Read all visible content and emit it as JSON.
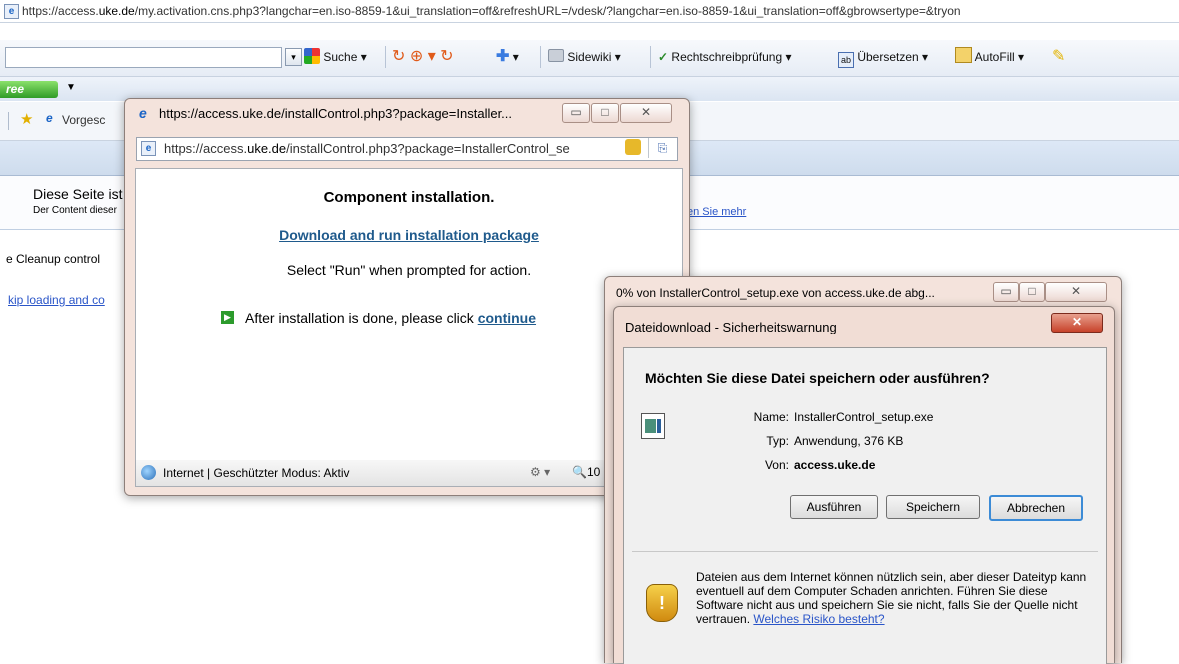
{
  "browser": {
    "url": "https://access.uke.de/my.activation.cns.php3?langchar=en.iso-8859-1&ui_translation=off&refreshURL=/vdesk/?langchar=en.iso-8859-1&ui_translation=off&gbrowsertype=&tryon",
    "url_prefix": "https://access.",
    "url_domain": "uke.de",
    "url_rest": "/my.activation.cns.php3?langchar=en.iso-8859-1&ui_translation=off&refreshURL=/vdesk/?langchar=en.iso-8859-1&ui_translation=off&gbrowsertype=&tryon",
    "toolbar": {
      "search": "Suche",
      "sidewiki": "Sidewiki",
      "spellcheck": "Rechtschreibprüfung",
      "translate": "Übersetzen",
      "autofill": "AutoFill"
    },
    "free_label": "ree",
    "favorites_label": "Vorgesc"
  },
  "page": {
    "info_title": "Diese Seite ist",
    "info_sub": "Der Content dieser",
    "info_link": "en Sie mehr",
    "cleanup_text": "e Cleanup control",
    "skip_link": "kip loading and co"
  },
  "popup": {
    "title": "https://access.uke.de/installControl.php3?package=Installer...",
    "address": "https://access.uke.de/installControl.php3?package=InstallerControl_se",
    "address_prefix": "https://access.",
    "address_domain": "uke.de",
    "address_rest": "/installControl.php3?package=InstallerControl_se",
    "heading": "Component installation.",
    "download_link": "Download and run installation package",
    "instruction": "Select \"Run\" when prompted for action.",
    "after_text": "After installation is done, please click",
    "continue_link": "continue",
    "status": "Internet | Geschützter Modus: Aktiv",
    "zoom": "10"
  },
  "progress_window": {
    "title": "0% von InstallerControl_setup.exe von access.uke.de abg..."
  },
  "dialog": {
    "title": "Dateidownload - Sicherheitswarnung",
    "question": "Möchten Sie diese Datei speichern oder ausführen?",
    "name_label": "Name:",
    "name_value": "InstallerControl_setup.exe",
    "type_label": "Typ:",
    "type_value": "Anwendung, 376 KB",
    "from_label": "Von:",
    "from_value": "access.uke.de",
    "btn_run": "Ausführen",
    "btn_save": "Speichern",
    "btn_cancel": "Abbrechen",
    "warning_text": "Dateien aus dem Internet können nützlich sein, aber dieser Dateityp kann eventuell auf dem Computer Schaden anrichten. Führen Sie diese Software nicht aus und speichern Sie sie nicht, falls Sie der Quelle nicht vertrauen.",
    "risk_link": "Welches Risiko besteht?"
  }
}
